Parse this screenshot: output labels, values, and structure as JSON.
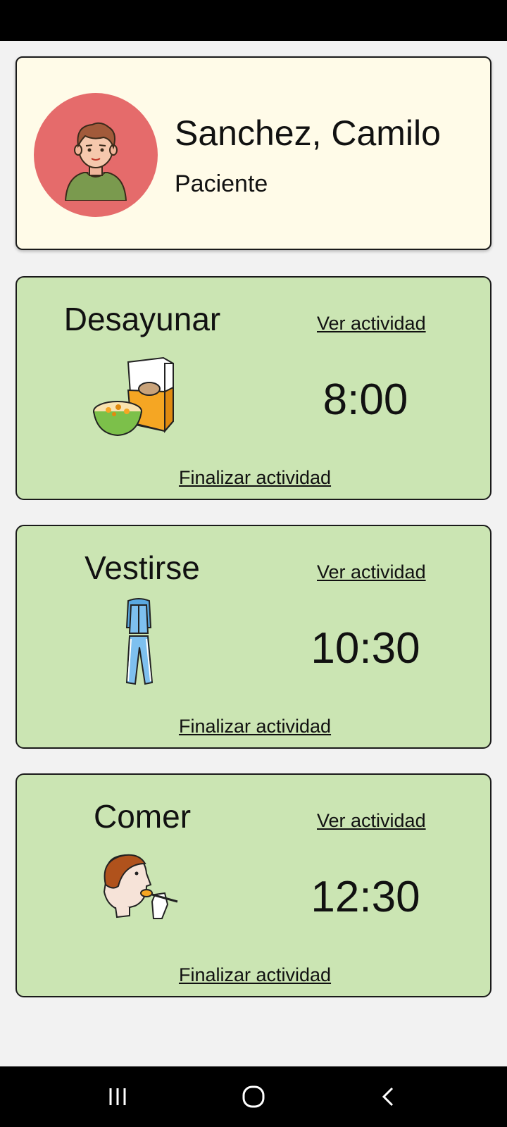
{
  "profile": {
    "name": "Sanchez, Camilo",
    "role": "Paciente",
    "avatar_icon": "boy-avatar-icon",
    "avatar_bg": "#e56b6b"
  },
  "activities": [
    {
      "title": "Desayunar",
      "view_label": "Ver actividad",
      "time": "8:00",
      "finish_label": "Finalizar actividad",
      "icon": "cereal-breakfast-icon"
    },
    {
      "title": "Vestirse",
      "view_label": "Ver actividad",
      "time": "10:30",
      "finish_label": "Finalizar actividad",
      "icon": "tracksuit-clothes-icon"
    },
    {
      "title": "Comer",
      "view_label": "Ver actividad",
      "time": "12:30",
      "finish_label": "Finalizar actividad",
      "icon": "eating-spoon-icon"
    }
  ],
  "colors": {
    "profile_card_bg": "#fffbe8",
    "activity_card_bg": "#cbe5b3",
    "page_bg": "#f2f2f2"
  },
  "nav": {
    "recents_icon": "recent-apps-icon",
    "home_icon": "home-icon",
    "back_icon": "back-icon"
  }
}
